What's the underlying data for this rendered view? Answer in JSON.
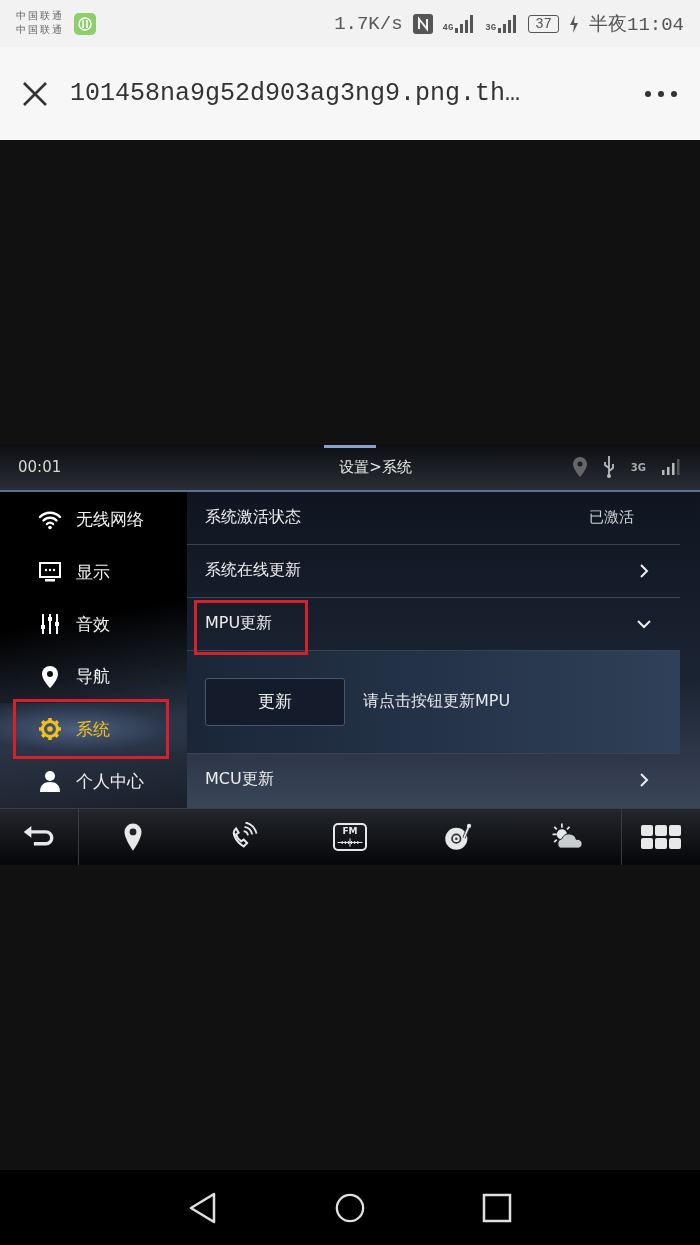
{
  "phone_status": {
    "carriers": [
      "中国联通",
      "中国联通"
    ],
    "speed": "1.7K/s",
    "network_labels": [
      "4G",
      "3G"
    ],
    "battery": "37",
    "time": "半夜11:04"
  },
  "viewer": {
    "title": "101458na9g52d903ag3ng9.png.th…"
  },
  "car_screen": {
    "time": "00:01",
    "breadcrumb": "设置>系统",
    "network_label": "3G",
    "sidebar": {
      "items": [
        {
          "label": "无线网络",
          "kind": "wifi",
          "selected": false,
          "highlighted": false
        },
        {
          "label": "显示",
          "kind": "display",
          "selected": false,
          "highlighted": false
        },
        {
          "label": "音效",
          "kind": "equalizer",
          "selected": false,
          "highlighted": false
        },
        {
          "label": "导航",
          "kind": "location",
          "selected": false,
          "highlighted": false
        },
        {
          "label": "系统",
          "kind": "gear",
          "selected": true,
          "highlighted": true
        },
        {
          "label": "个人中心",
          "kind": "person",
          "selected": false,
          "highlighted": false
        }
      ]
    },
    "settings": [
      {
        "label": "系统激活状态",
        "kind": "value",
        "value": "已激活",
        "highlighted": false
      },
      {
        "label": "系统在线更新",
        "kind": "link",
        "highlighted": false
      },
      {
        "label": "MPU更新",
        "kind": "expandable",
        "expanded": true,
        "highlighted": true,
        "button": "更新",
        "hint": "请点击按钮更新MPU"
      },
      {
        "label": "MCU更新",
        "kind": "link",
        "highlighted": false
      }
    ],
    "dock": [
      {
        "kind": "back"
      },
      {
        "kind": "navigation"
      },
      {
        "kind": "phone"
      },
      {
        "kind": "radio",
        "label": "FM"
      },
      {
        "kind": "music"
      },
      {
        "kind": "weather"
      },
      {
        "kind": "apps"
      }
    ]
  },
  "nav_bar": [
    {
      "kind": "back"
    },
    {
      "kind": "home"
    },
    {
      "kind": "recents"
    }
  ]
}
